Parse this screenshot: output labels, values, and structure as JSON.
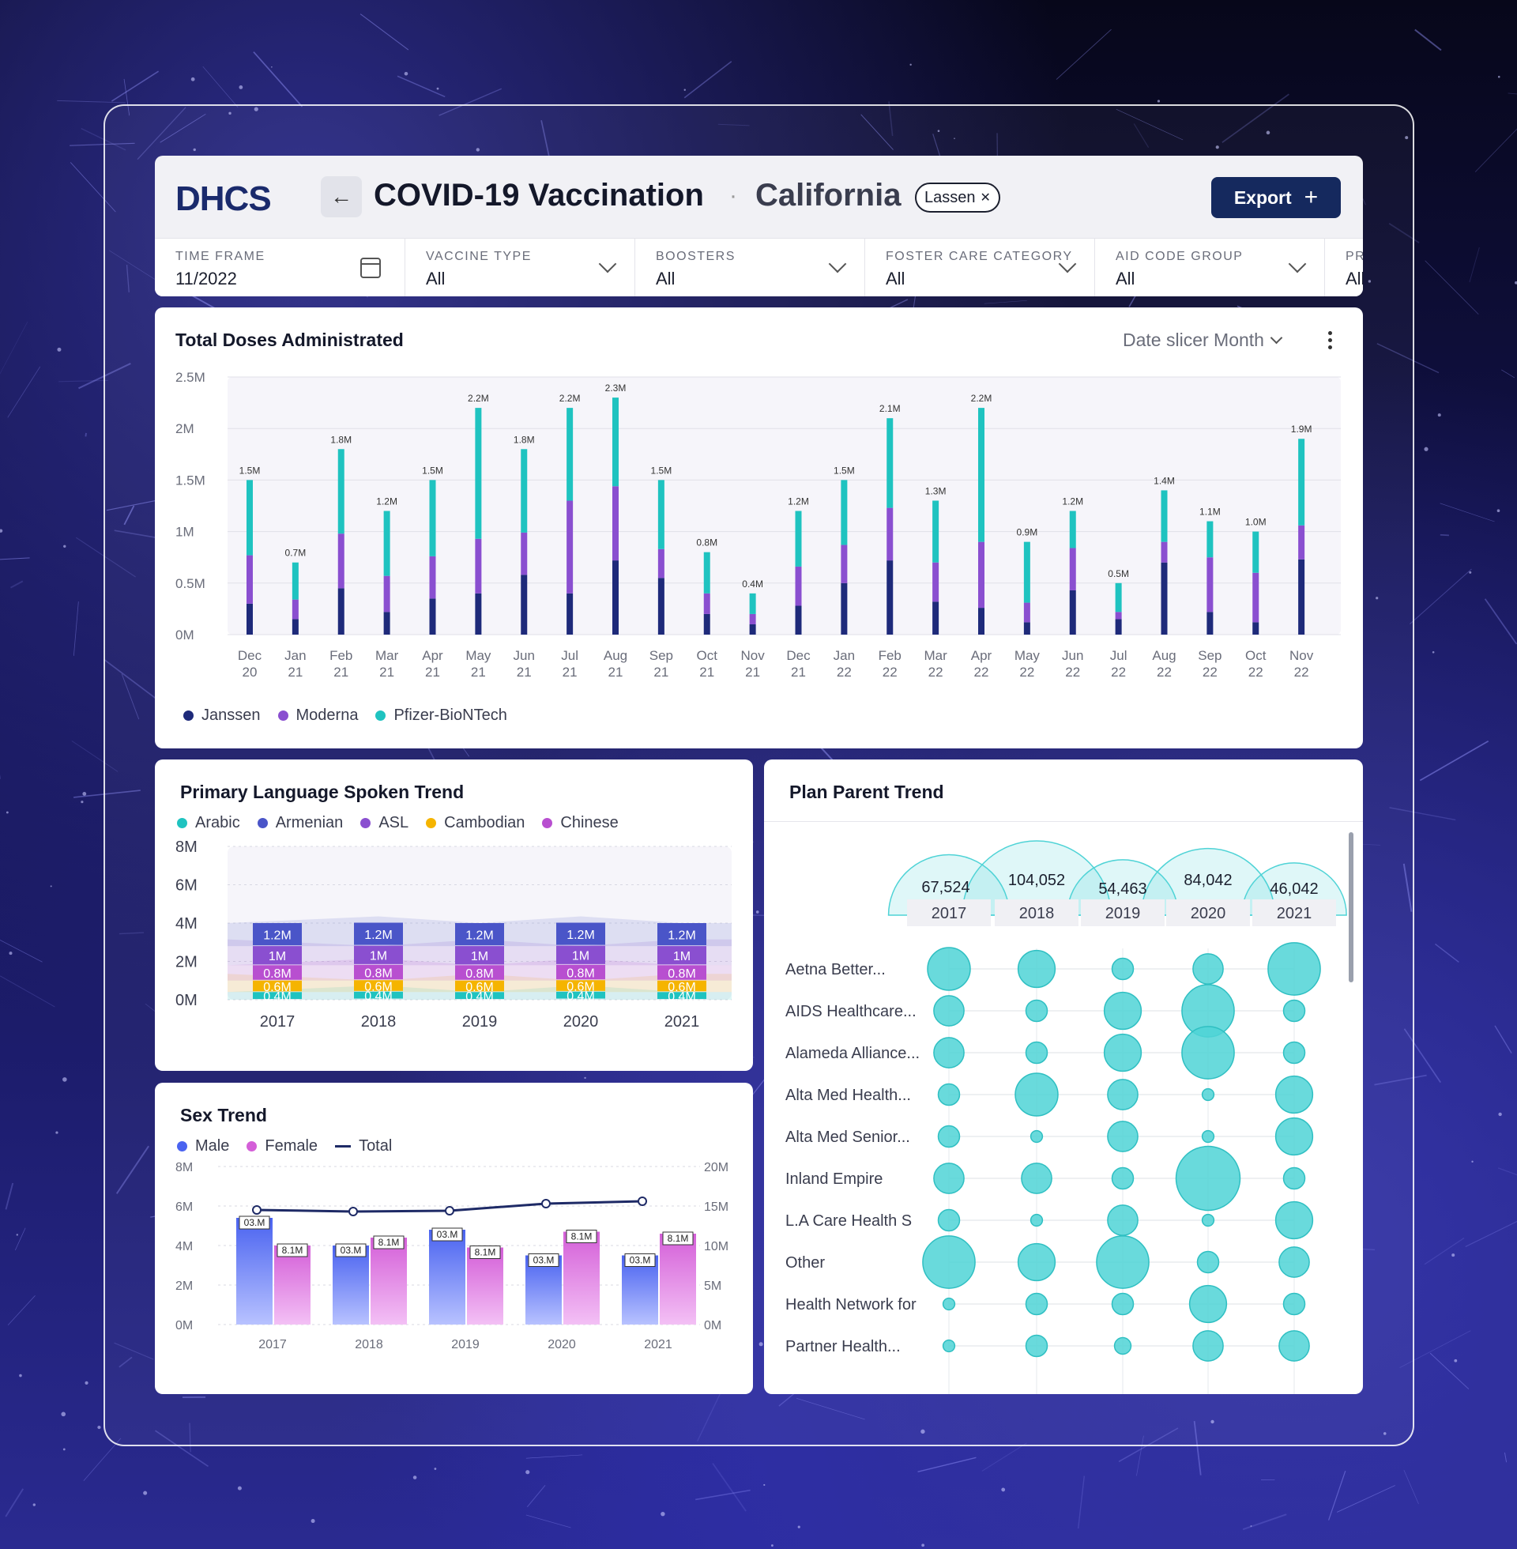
{
  "header": {
    "logo": "DHCS",
    "back_icon": "←",
    "title": "COVID-19 Vaccination",
    "separator": "·",
    "subtitle": "California",
    "chip_label": "Lassen",
    "chip_close": "✕",
    "export_label": "Export",
    "export_icon": "+"
  },
  "filters": [
    {
      "label": "TIME FRAME",
      "value": "11/2022",
      "icon": "calendar-icon"
    },
    {
      "label": "VACCINE TYPE",
      "value": "All",
      "icon": "chevron-down-icon"
    },
    {
      "label": "BOOSTERS",
      "value": "All",
      "icon": "chevron-down-icon"
    },
    {
      "label": "FOSTER CARE CATEGORY",
      "value": "All",
      "icon": "chevron-down-icon"
    },
    {
      "label": "AID CODE GROUP",
      "value": "All",
      "icon": "chevron-down-icon"
    },
    {
      "label": "PR",
      "value": "All",
      "icon": ""
    }
  ],
  "colors": {
    "janssen": "#1e2a7a",
    "moderna": "#8a4fd0",
    "pfizer": "#1fc3c0",
    "arabic": "#1fc3c0",
    "armenian": "#4a55c8",
    "asl": "#8a4fd0",
    "cambodian": "#f5b400",
    "chinese": "#b84fd0",
    "male": "#4a63f0",
    "female": "#d45fd8",
    "total": "#1e2a66",
    "bubble": "#4fd3d6",
    "export_bg": "#15295e"
  },
  "doses": {
    "title": "Total Doses Administrated",
    "slicer_label": "Date slicer Month",
    "legend": [
      "Janssen",
      "Moderna",
      "Pfizer-BioNTech"
    ]
  },
  "language": {
    "title": "Primary Language Spoken Trend",
    "legend": [
      "Arabic",
      "Armenian",
      "ASL",
      "Cambodian",
      "Chinese"
    ]
  },
  "sex": {
    "title": "Sex Trend",
    "legend": [
      "Male",
      "Female",
      "Total"
    ]
  },
  "plan": {
    "title": "Plan Parent Trend"
  },
  "chart_data": [
    {
      "id": "doses",
      "type": "bar",
      "stacked": true,
      "title": "Total Doses Administrated",
      "categories": [
        "Dec 20",
        "Jan 21",
        "Feb 21",
        "Mar 21",
        "Apr 21",
        "May 21",
        "Jun 21",
        "Jul 21",
        "Aug 21",
        "Sep 21",
        "Oct 21",
        "Nov 21",
        "Dec 21",
        "Jan 22",
        "Feb 22",
        "Mar 22",
        "Apr 22",
        "May 22",
        "Jun 22",
        "Jul 22",
        "Aug 22",
        "Sep 22",
        "Oct 22",
        "Nov 22"
      ],
      "totals": [
        1.5,
        0.7,
        1.8,
        1.2,
        1.5,
        2.2,
        1.8,
        2.2,
        2.3,
        1.5,
        0.8,
        0.4,
        1.2,
        1.5,
        2.1,
        1.3,
        2.2,
        0.9,
        1.2,
        0.5,
        1.4,
        1.1,
        1.0,
        1.9
      ],
      "total_labels": [
        "1.5M",
        "0.7M",
        "1.8M",
        "1.2M",
        "1.5M",
        "2.2M",
        "1.8M",
        "2.2M",
        "2.3M",
        "1.5M",
        "0.8M",
        "0.4M",
        "1.2M",
        "1.5M",
        "2.1M",
        "1.3M",
        "2.2M",
        "0.9M",
        "1.2M",
        "0.5M",
        "1.4M",
        "1.1M",
        "1.0M",
        "1.9M"
      ],
      "series": [
        {
          "name": "Janssen",
          "values": [
            0.3,
            0.15,
            0.45,
            0.22,
            0.35,
            0.4,
            0.58,
            0.4,
            0.72,
            0.55,
            0.2,
            0.1,
            0.28,
            0.5,
            0.72,
            0.32,
            0.26,
            0.12,
            0.43,
            0.15,
            0.7,
            0.22,
            0.12,
            0.73
          ]
        },
        {
          "name": "Moderna",
          "values": [
            0.47,
            0.19,
            0.53,
            0.35,
            0.41,
            0.53,
            0.41,
            0.9,
            0.72,
            0.28,
            0.2,
            0.1,
            0.38,
            0.37,
            0.51,
            0.38,
            0.64,
            0.19,
            0.41,
            0.07,
            0.2,
            0.53,
            0.48,
            0.33
          ]
        },
        {
          "name": "Pfizer-BioNTech",
          "values": [
            0.73,
            0.36,
            0.82,
            0.63,
            0.74,
            1.27,
            0.81,
            0.9,
            0.86,
            0.67,
            0.4,
            0.2,
            0.54,
            0.63,
            0.87,
            0.6,
            1.3,
            0.59,
            0.36,
            0.28,
            0.5,
            0.35,
            0.4,
            0.84
          ]
        }
      ],
      "ylabel_ticks": [
        "0M",
        "0.5M",
        "1M",
        "1.5M",
        "2M",
        "2.5M"
      ],
      "ylim": [
        0,
        2.5
      ]
    },
    {
      "id": "language",
      "type": "bar",
      "stacked": true,
      "title": "Primary Language Spoken Trend",
      "categories": [
        "2017",
        "2018",
        "2019",
        "2020",
        "2021"
      ],
      "series": [
        {
          "name": "Arabic",
          "values": [
            0.4,
            0.4,
            0.4,
            0.4,
            0.4
          ],
          "labels": [
            "0.4M",
            "0.4M",
            "0.4M",
            "0.4M",
            "0.4M"
          ]
        },
        {
          "name": "Cambodian",
          "values": [
            0.6,
            0.6,
            0.6,
            0.6,
            0.6
          ],
          "labels": [
            "0.6M",
            "0.6M",
            "0.6M",
            "0.6M",
            "0.6M"
          ]
        },
        {
          "name": "Chinese",
          "values": [
            0.8,
            0.8,
            0.8,
            0.8,
            0.8
          ],
          "labels": [
            "0.8M",
            "0.8M",
            "0.8M",
            "0.8M",
            "0.8M"
          ]
        },
        {
          "name": "ASL",
          "values": [
            1.0,
            1.0,
            1.0,
            1.0,
            1.0
          ],
          "labels": [
            "1M",
            "1M",
            "1M",
            "1M",
            "1M"
          ]
        },
        {
          "name": "Armenian",
          "values": [
            1.2,
            1.2,
            1.2,
            1.2,
            1.2
          ],
          "labels": [
            "1.2M",
            "1.2M",
            "1.2M",
            "1.2M",
            "1.2M"
          ]
        }
      ],
      "ylabel_ticks": [
        "0M",
        "2M",
        "4M",
        "6M",
        "8M"
      ],
      "ylim": [
        0,
        8
      ]
    },
    {
      "id": "sex",
      "type": "bar",
      "title": "Sex Trend",
      "categories": [
        "2017",
        "2018",
        "2019",
        "2020",
        "2021"
      ],
      "series": [
        {
          "name": "Male",
          "values": [
            5.4,
            4.0,
            4.8,
            3.5,
            3.5
          ],
          "labels": [
            "03.M",
            "03.M",
            "03.M",
            "03.M",
            "03.M"
          ]
        },
        {
          "name": "Female",
          "values": [
            4.0,
            4.4,
            3.9,
            4.7,
            4.6
          ],
          "labels": [
            "8.1M",
            "8.1M",
            "8.1M",
            "8.1M",
            "8.1M"
          ]
        },
        {
          "name": "Total",
          "type": "line",
          "axis": "right",
          "values": [
            14.5,
            14.3,
            14.4,
            15.3,
            15.6
          ]
        }
      ],
      "ylabel_ticks": [
        "0M",
        "2M",
        "4M",
        "6M",
        "8M"
      ],
      "y2label_ticks": [
        "0M",
        "5M",
        "10M",
        "15M",
        "20M"
      ],
      "ylim": [
        0,
        8
      ],
      "y2lim": [
        0,
        20
      ]
    },
    {
      "id": "plan",
      "type": "scatter",
      "title": "Plan Parent Trend",
      "years": [
        "2017",
        "2018",
        "2019",
        "2020",
        "2021"
      ],
      "totals": [
        67524,
        104052,
        54463,
        84042,
        46042
      ],
      "total_labels": [
        "67,524",
        "104,052",
        "54,463",
        "84,042",
        "46,042"
      ],
      "rows": [
        "Aetna Better...",
        "AIDS Healthcare...",
        "Alameda Alliance...",
        "Alta Med Health...",
        "Alta Med Senior...",
        "Inland Empire",
        "L.A Care Health S",
        "Other",
        "Health Network for",
        "Partner Health..."
      ],
      "sizes": [
        [
          4,
          3,
          1,
          2,
          6
        ],
        [
          2,
          1,
          3,
          6,
          1
        ],
        [
          2,
          1,
          3,
          6,
          1
        ],
        [
          1,
          4,
          2,
          0.3,
          3
        ],
        [
          1,
          0.3,
          2,
          0.3,
          3
        ],
        [
          2,
          2,
          1,
          9,
          1
        ],
        [
          1,
          0.3,
          2,
          0.3,
          3
        ],
        [
          6,
          3,
          6,
          1,
          2
        ],
        [
          0.3,
          1,
          1,
          3,
          1
        ],
        [
          0.3,
          1,
          0.6,
          2,
          2
        ]
      ]
    }
  ]
}
